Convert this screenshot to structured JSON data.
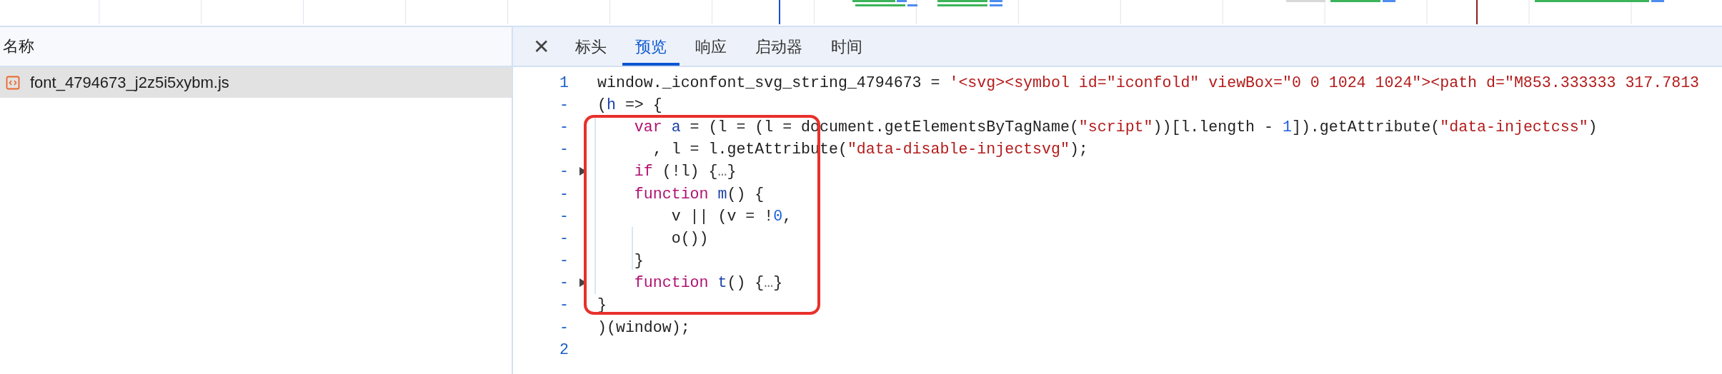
{
  "requests": {
    "column": "名称",
    "rows": [
      {
        "name": "font_4794673_j2z5i5xybm.js",
        "selected": true
      }
    ]
  },
  "close": "✕",
  "tabs": [
    {
      "label": "标头",
      "selected": false
    },
    {
      "label": "预览",
      "selected": true
    },
    {
      "label": "响应",
      "selected": false
    },
    {
      "label": "启动器",
      "selected": false
    },
    {
      "label": "时间",
      "selected": false
    }
  ],
  "code": [
    {
      "number": "1",
      "foldable": false,
      "tokens": [
        {
          "kind": "plain",
          "text": "window._iconfont_svg_string_4794673 = "
        },
        {
          "kind": "string",
          "text": "'<svg><symbol id=\"iconfold\" viewBox=\"0 0 1024 1024\"><path d=\"M853.333333 317.7813"
        }
      ]
    },
    {
      "number": "-",
      "foldable": false,
      "tokens": [
        {
          "kind": "plain",
          "text": "("
        },
        {
          "kind": "name",
          "text": "h"
        },
        {
          "kind": "plain",
          "text": " => {"
        }
      ]
    },
    {
      "number": "-",
      "foldable": false,
      "tokens": [
        {
          "kind": "keyword",
          "text": "    var"
        },
        {
          "kind": "name",
          "text": " a"
        },
        {
          "kind": "plain",
          "text": " = (l = (l = document.getElementsByTagName("
        },
        {
          "kind": "string",
          "text": "\"script\""
        },
        {
          "kind": "plain",
          "text": "))[l.length - "
        },
        {
          "kind": "number",
          "text": "1"
        },
        {
          "kind": "plain",
          "text": "]).getAttribute("
        },
        {
          "kind": "string",
          "text": "\"data-injectcss\""
        },
        {
          "kind": "plain",
          "text": ")"
        }
      ]
    },
    {
      "number": "-",
      "foldable": false,
      "tokens": [
        {
          "kind": "plain",
          "text": "      , l = l.getAttribute("
        },
        {
          "kind": "string",
          "text": "\"data-disable-injectsvg\""
        },
        {
          "kind": "plain",
          "text": ");"
        }
      ]
    },
    {
      "number": "-",
      "foldable": true,
      "tokens": [
        {
          "kind": "keyword",
          "text": "    if"
        },
        {
          "kind": "plain",
          "text": " (!l) {"
        },
        {
          "kind": "ellipsis",
          "text": "…"
        },
        {
          "kind": "plain",
          "text": "}"
        }
      ]
    },
    {
      "number": "-",
      "foldable": false,
      "tokens": [
        {
          "kind": "keyword",
          "text": "    function"
        },
        {
          "kind": "name",
          "text": " m"
        },
        {
          "kind": "plain",
          "text": "() {"
        }
      ]
    },
    {
      "number": "-",
      "foldable": false,
      "tokens": [
        {
          "kind": "plain",
          "text": "        v || (v = !"
        },
        {
          "kind": "number",
          "text": "0"
        },
        {
          "kind": "plain",
          "text": ","
        }
      ]
    },
    {
      "number": "-",
      "foldable": false,
      "tokens": [
        {
          "kind": "plain",
          "text": "        o())"
        }
      ]
    },
    {
      "number": "-",
      "foldable": false,
      "tokens": [
        {
          "kind": "plain",
          "text": "    }"
        }
      ]
    },
    {
      "number": "-",
      "foldable": true,
      "tokens": [
        {
          "kind": "keyword",
          "text": "    function"
        },
        {
          "kind": "name",
          "text": " t"
        },
        {
          "kind": "plain",
          "text": "() {"
        },
        {
          "kind": "ellipsis",
          "text": "…"
        },
        {
          "kind": "plain",
          "text": "}"
        }
      ]
    },
    {
      "number": "-",
      "foldable": false,
      "tokens": [
        {
          "kind": "plain",
          "text": "}"
        }
      ]
    },
    {
      "number": "-",
      "foldable": false,
      "tokens": [
        {
          "kind": "plain",
          "text": ")(window);"
        }
      ]
    },
    {
      "number": "2",
      "foldable": false
    }
  ]
}
